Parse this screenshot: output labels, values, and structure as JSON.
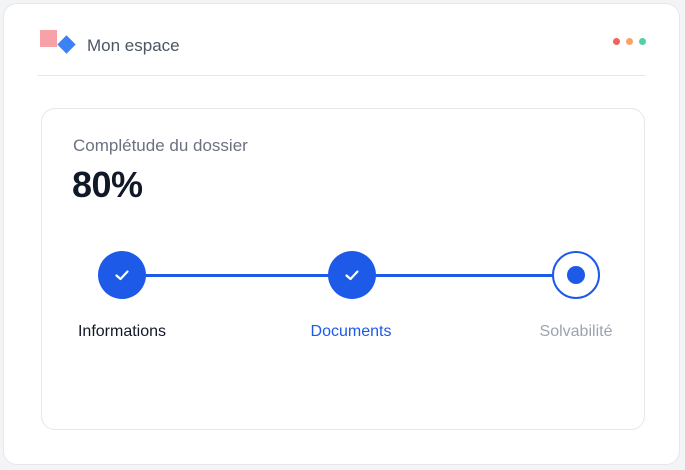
{
  "header": {
    "title": "Mon espace",
    "window_dots": [
      "#f0625a",
      "#f5a36b",
      "#4fd1a5"
    ]
  },
  "progress_card": {
    "label": "Complétude du dossier",
    "value": "80%",
    "steps": [
      {
        "label": "Informations",
        "status": "done"
      },
      {
        "label": "Documents",
        "status": "active"
      },
      {
        "label": "Solvabilité",
        "status": "current"
      }
    ]
  },
  "colors": {
    "accent": "#1d5ae8",
    "logo_square": "#f7a1a8",
    "logo_diamond": "#3b82f6"
  }
}
